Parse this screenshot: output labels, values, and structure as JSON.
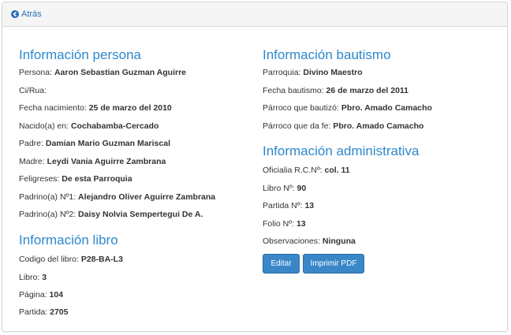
{
  "header": {
    "back_label": "Atrás"
  },
  "persona": {
    "title": "Información persona",
    "rows": [
      {
        "label": "Persona:",
        "value": "Aaron Sebastian Guzman Aguirre"
      },
      {
        "label": "Ci/Rua:",
        "value": ""
      },
      {
        "label": "Fecha nacimiento:",
        "value": "25 de marzo del 2010"
      },
      {
        "label": "Nacido(a) en:",
        "value": "Cochabamba-Cercado"
      },
      {
        "label": "Padre:",
        "value": "Damian Mario Guzman Mariscal"
      },
      {
        "label": "Madre:",
        "value": "Leydi Vania Aguirre Zambrana"
      },
      {
        "label": "Feligreses:",
        "value": "De esta Parroquia"
      },
      {
        "label": "Padrino(a) Nº1:",
        "value": "Alejandro Oliver Aguirre Zambrana"
      },
      {
        "label": "Padrino(a) Nº2:",
        "value": "Daisy Nolvia Sempertegui De A."
      }
    ]
  },
  "libro": {
    "title": "Información libro",
    "rows": [
      {
        "label": "Codigo del libro:",
        "value": "P28-BA-L3"
      },
      {
        "label": "Libro:",
        "value": "3"
      },
      {
        "label": "Página:",
        "value": "104"
      },
      {
        "label": "Partida:",
        "value": "2705"
      }
    ]
  },
  "bautismo": {
    "title": "Información bautismo",
    "rows": [
      {
        "label": "Parroquia:",
        "value": "Divino Maestro"
      },
      {
        "label": "Fecha bautismo:",
        "value": "26 de marzo del 2011"
      },
      {
        "label": "Párroco que bautizó:",
        "value": "Pbro. Amado Camacho"
      },
      {
        "label": "Párroco que da fe:",
        "value": "Pbro. Amado Camacho"
      }
    ]
  },
  "administrativa": {
    "title": "Información administrativa",
    "rows": [
      {
        "label": "Oficialia R.C.Nº:",
        "value": "col. 11"
      },
      {
        "label": "Libro Nº:",
        "value": "90"
      },
      {
        "label": "Partida Nº:",
        "value": "13"
      },
      {
        "label": "Folio Nº:",
        "value": "13"
      },
      {
        "label": "Observaciones:",
        "value": "Ninguna"
      }
    ]
  },
  "actions": {
    "edit_label": "Editar",
    "print_label": "Imprimir PDF"
  }
}
